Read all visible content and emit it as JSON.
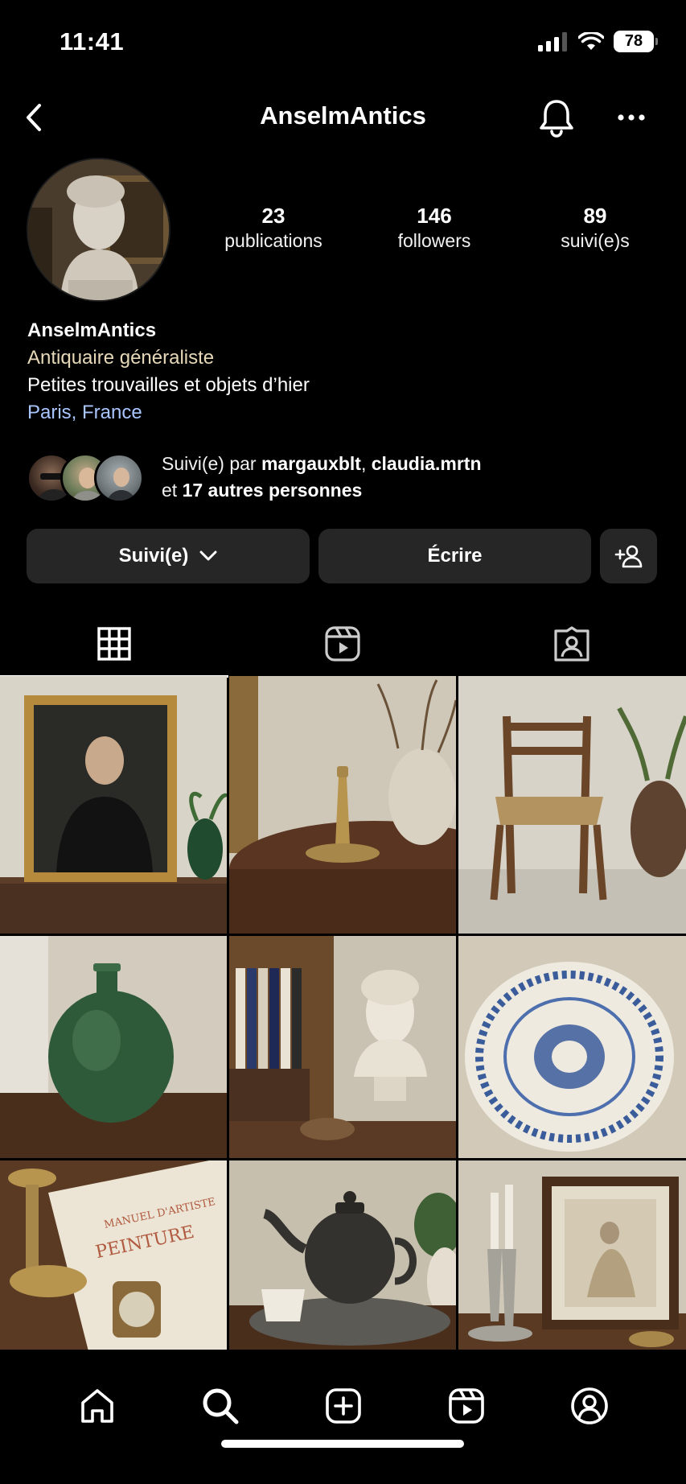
{
  "status_bar": {
    "time": "11:41",
    "battery": "78"
  },
  "nav": {
    "title": "AnselmAntics"
  },
  "stats": [
    {
      "value": "23",
      "label": "publications"
    },
    {
      "value": "146",
      "label": "followers"
    },
    {
      "value": "89",
      "label": "suivi(e)s"
    }
  ],
  "bio": {
    "name": "AnselmAntics",
    "category": "Antiquaire généraliste",
    "description": "Petites trouvailles et objets d’hier",
    "location": "Paris, France"
  },
  "followed_by": {
    "prefix": "Suivi(e) par ",
    "user1": "margauxblt",
    "separator": ", ",
    "user2": "claudia.mrtn",
    "line2_prefix": "et ",
    "others": "17 autres personnes"
  },
  "buttons": {
    "following": "Suivi(e)",
    "message": "Écrire"
  },
  "tabs": [
    "grid-icon",
    "reels-icon",
    "tagged-icon"
  ],
  "bottom_nav": [
    "home-icon",
    "search-icon",
    "create-icon",
    "reels-icon",
    "profile-icon"
  ],
  "colors": {
    "background": "#000000",
    "button": "#262626",
    "category": "#e6d8b8",
    "location": "#a9c6ff"
  }
}
